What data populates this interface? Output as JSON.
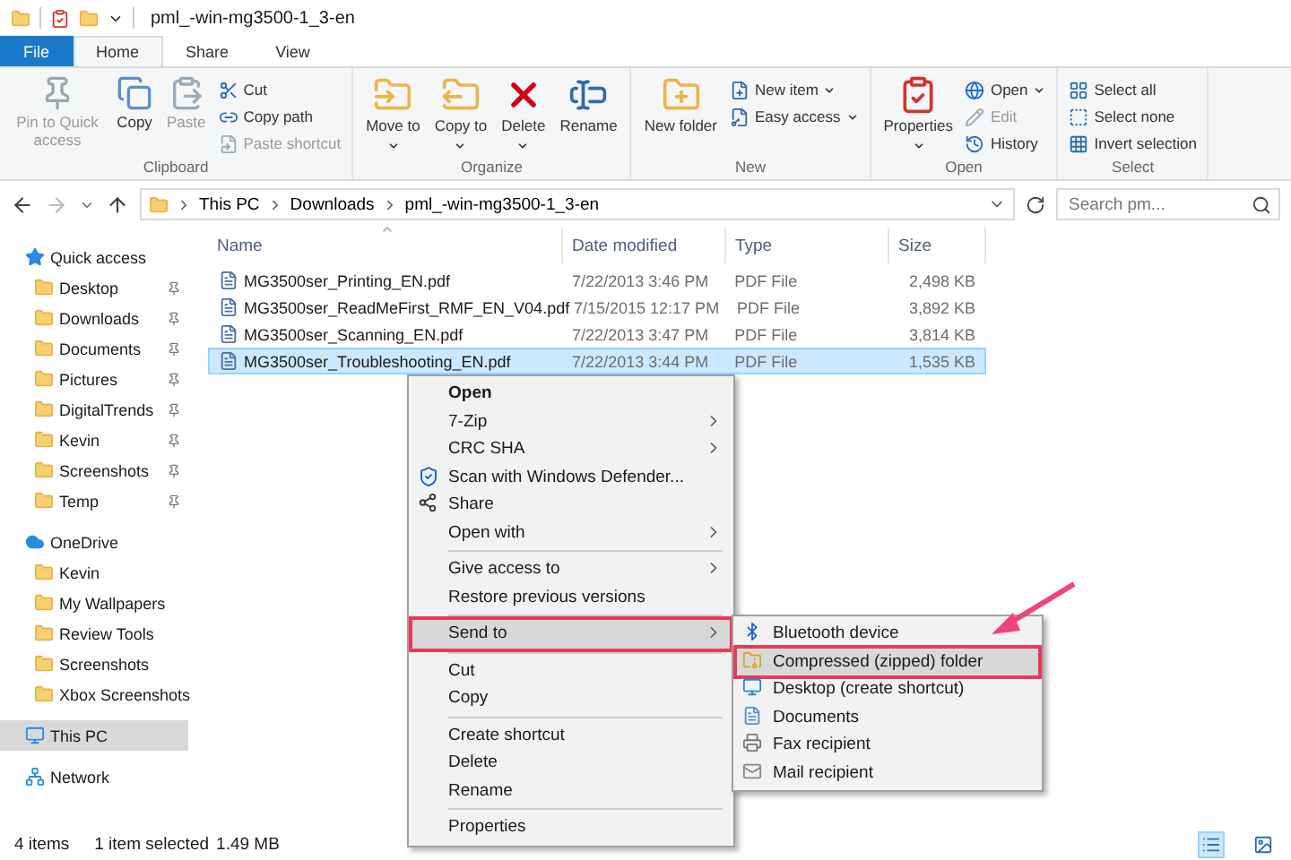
{
  "window": {
    "title": "pml_-win-mg3500-1_3-en"
  },
  "tabs": [
    {
      "label": "File",
      "selected": false,
      "kind": "file"
    },
    {
      "label": "Home",
      "selected": true,
      "kind": "tab"
    },
    {
      "label": "Share",
      "selected": false,
      "kind": "tab"
    },
    {
      "label": "View",
      "selected": false,
      "kind": "tab"
    }
  ],
  "ribbon": [
    {
      "label": "Clipboard",
      "buttons": [
        {
          "label": "Pin to Quick access",
          "disabled": true,
          "dropdown": false
        },
        {
          "label": "Copy",
          "disabled": false,
          "dropdown": false
        },
        {
          "label": "Paste",
          "disabled": true,
          "dropdown": false
        }
      ],
      "small_buttons": [
        {
          "label": "Cut",
          "disabled": false,
          "dropdown": false
        },
        {
          "label": "Copy path",
          "disabled": false,
          "dropdown": false
        },
        {
          "label": "Paste shortcut",
          "disabled": true,
          "dropdown": false
        }
      ]
    },
    {
      "label": "Organize",
      "buttons": [
        {
          "label": "Move to",
          "disabled": false,
          "dropdown": true
        },
        {
          "label": "Copy to",
          "disabled": false,
          "dropdown": true
        },
        {
          "label": "Delete",
          "disabled": false,
          "dropdown": true
        },
        {
          "label": "Rename",
          "disabled": false,
          "dropdown": false
        }
      ]
    },
    {
      "label": "New",
      "buttons": [
        {
          "label": "New folder",
          "disabled": false,
          "dropdown": false
        }
      ],
      "small_buttons": [
        {
          "label": "New item",
          "disabled": false,
          "dropdown": true
        },
        {
          "label": "Easy access",
          "disabled": false,
          "dropdown": true
        }
      ]
    },
    {
      "label": "Open",
      "buttons": [
        {
          "label": "Properties",
          "disabled": false,
          "dropdown": true
        }
      ],
      "small_buttons": [
        {
          "label": "Open",
          "disabled": false,
          "dropdown": true
        },
        {
          "label": "Edit",
          "disabled": true,
          "dropdown": false
        },
        {
          "label": "History",
          "disabled": false,
          "dropdown": false
        }
      ]
    },
    {
      "label": "Select",
      "small_buttons": [
        {
          "label": "Select all",
          "disabled": false,
          "dropdown": false
        },
        {
          "label": "Select none",
          "disabled": false,
          "dropdown": false
        },
        {
          "label": "Invert selection",
          "disabled": false,
          "dropdown": false
        }
      ]
    }
  ],
  "address": {
    "crumbs": [
      "This PC",
      "Downloads",
      "pml_-win-mg3500-1_3-en"
    ]
  },
  "search": {
    "placeholder": "Search pm..."
  },
  "sidebar": {
    "items": [
      {
        "label": "Quick access",
        "selected": false,
        "kind": "quick",
        "children": [
          {
            "label": "Desktop",
            "selected": false,
            "pinned": true
          },
          {
            "label": "Downloads",
            "selected": false,
            "pinned": true
          },
          {
            "label": "Documents",
            "selected": false,
            "pinned": true
          },
          {
            "label": "Pictures",
            "selected": false,
            "pinned": true
          },
          {
            "label": "DigitalTrends",
            "selected": false,
            "pinned": true
          },
          {
            "label": "Kevin",
            "selected": false,
            "pinned": true
          },
          {
            "label": "Screenshots",
            "selected": false,
            "pinned": true
          },
          {
            "label": "Temp",
            "selected": false,
            "pinned": true
          }
        ]
      },
      {
        "label": "OneDrive",
        "selected": false,
        "kind": "cloud",
        "children": [
          {
            "label": "Kevin",
            "selected": false,
            "pinned": false
          },
          {
            "label": "My Wallpapers",
            "selected": false,
            "pinned": false
          },
          {
            "label": "Review Tools",
            "selected": false,
            "pinned": false
          },
          {
            "label": "Screenshots",
            "selected": false,
            "pinned": false
          },
          {
            "label": "Xbox Screenshots",
            "selected": false,
            "pinned": false
          }
        ]
      },
      {
        "label": "This PC",
        "selected": true,
        "kind": "pc"
      },
      {
        "label": "Network",
        "selected": false,
        "kind": "network"
      }
    ]
  },
  "table": {
    "columns": [
      "Name",
      "Date modified",
      "Type",
      "Size"
    ],
    "rows": [
      {
        "name": "MG3500ser_Printing_EN.pdf",
        "date": "7/22/2013 3:46 PM",
        "type": "PDF File",
        "size": "2,498 KB",
        "selected": false
      },
      {
        "name": "MG3500ser_ReadMeFirst_RMF_EN_V04.pdf",
        "date": "7/15/2015 12:17 PM",
        "type": "PDF File",
        "size": "3,892 KB",
        "selected": false
      },
      {
        "name": "MG3500ser_Scanning_EN.pdf",
        "date": "7/22/2013 3:47 PM",
        "type": "PDF File",
        "size": "3,814 KB",
        "selected": false
      },
      {
        "name": "MG3500ser_Troubleshooting_EN.pdf",
        "date": "7/22/2013 3:44 PM",
        "type": "PDF File",
        "size": "1,535 KB",
        "selected": true
      }
    ]
  },
  "context_menu": {
    "items": [
      {
        "kind": "item",
        "label": "Open",
        "bold": true,
        "submenu": false,
        "highlighted": false
      },
      {
        "kind": "item",
        "label": "7-Zip",
        "bold": false,
        "submenu": true,
        "highlighted": false
      },
      {
        "kind": "item",
        "label": "CRC SHA",
        "bold": false,
        "submenu": true,
        "highlighted": false
      },
      {
        "kind": "item",
        "label": "Scan with Windows Defender...",
        "bold": false,
        "submenu": false,
        "highlighted": false
      },
      {
        "kind": "item",
        "label": "Share",
        "bold": false,
        "submenu": false,
        "highlighted": false
      },
      {
        "kind": "item",
        "label": "Open with",
        "bold": false,
        "submenu": true,
        "highlighted": false
      },
      {
        "kind": "separator"
      },
      {
        "kind": "item",
        "label": "Give access to",
        "bold": false,
        "submenu": true,
        "highlighted": false
      },
      {
        "kind": "item",
        "label": "Restore previous versions",
        "bold": false,
        "submenu": false,
        "highlighted": false
      },
      {
        "kind": "separator"
      },
      {
        "kind": "item",
        "label": "Send to",
        "bold": false,
        "submenu": true,
        "highlighted": true
      },
      {
        "kind": "separator"
      },
      {
        "kind": "item",
        "label": "Cut",
        "bold": false,
        "submenu": false,
        "highlighted": false
      },
      {
        "kind": "item",
        "label": "Copy",
        "bold": false,
        "submenu": false,
        "highlighted": false
      },
      {
        "kind": "separator"
      },
      {
        "kind": "item",
        "label": "Create shortcut",
        "bold": false,
        "submenu": false,
        "highlighted": false
      },
      {
        "kind": "item",
        "label": "Delete",
        "bold": false,
        "submenu": false,
        "highlighted": false
      },
      {
        "kind": "item",
        "label": "Rename",
        "bold": false,
        "submenu": false,
        "highlighted": false
      },
      {
        "kind": "separator"
      },
      {
        "kind": "item",
        "label": "Properties",
        "bold": false,
        "submenu": false,
        "highlighted": false
      }
    ]
  },
  "send_to_menu": {
    "items": [
      {
        "label": "Bluetooth device",
        "highlighted": false
      },
      {
        "label": "Compressed (zipped) folder",
        "highlighted": true
      },
      {
        "label": "Desktop (create shortcut)",
        "highlighted": false
      },
      {
        "label": "Documents",
        "highlighted": false
      },
      {
        "label": "Fax recipient",
        "highlighted": false
      },
      {
        "label": "Mail recipient",
        "highlighted": false
      }
    ]
  },
  "status_bar": {
    "item_count": "4 items",
    "selection": "1 item selected",
    "size": "1.49 MB",
    "view_buttons": [
      {
        "selected": true
      },
      {
        "selected": false
      }
    ]
  }
}
